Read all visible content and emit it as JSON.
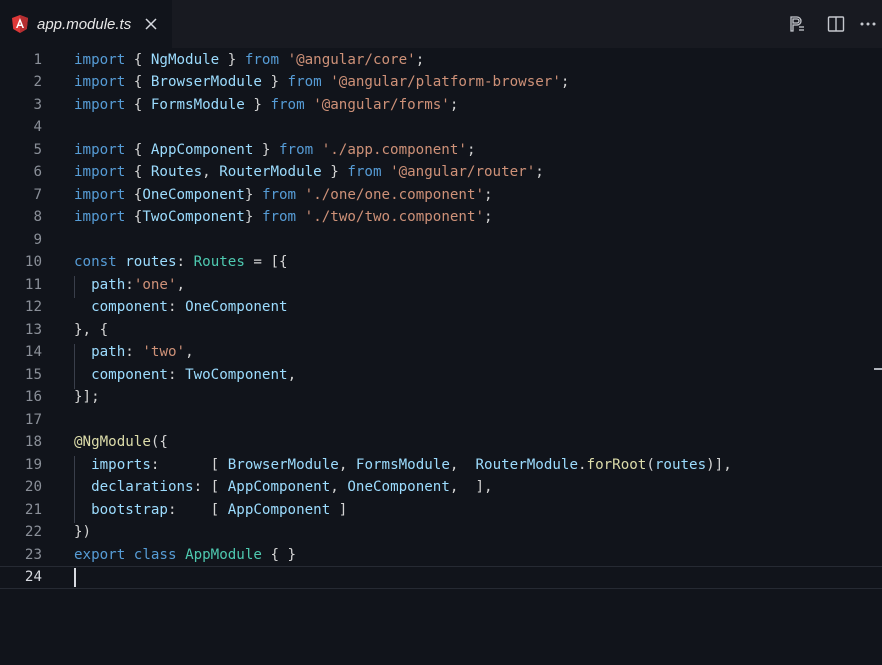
{
  "tab": {
    "title": "app.module.ts",
    "icon": "angular-icon",
    "close_icon": "close-icon"
  },
  "toolbar": {
    "icons": [
      "preview-icon",
      "split-editor-icon",
      "more-actions-icon"
    ]
  },
  "editor": {
    "language": "typescript",
    "current_line": 24,
    "lines": [
      {
        "n": "1",
        "tokens": [
          [
            "kw",
            "import"
          ],
          [
            "punc",
            " { "
          ],
          [
            "id",
            "NgModule"
          ],
          [
            "punc",
            " } "
          ],
          [
            "kw",
            "from"
          ],
          [
            "punc",
            " "
          ],
          [
            "str",
            "'@angular/core'"
          ],
          [
            "punc",
            ";"
          ]
        ]
      },
      {
        "n": "2",
        "tokens": [
          [
            "kw",
            "import"
          ],
          [
            "punc",
            " { "
          ],
          [
            "id",
            "BrowserModule"
          ],
          [
            "punc",
            " } "
          ],
          [
            "kw",
            "from"
          ],
          [
            "punc",
            " "
          ],
          [
            "str",
            "'@angular/platform-browser'"
          ],
          [
            "punc",
            ";"
          ]
        ]
      },
      {
        "n": "3",
        "tokens": [
          [
            "kw",
            "import"
          ],
          [
            "punc",
            " { "
          ],
          [
            "id",
            "FormsModule"
          ],
          [
            "punc",
            " } "
          ],
          [
            "kw",
            "from"
          ],
          [
            "punc",
            " "
          ],
          [
            "str",
            "'@angular/forms'"
          ],
          [
            "punc",
            ";"
          ]
        ]
      },
      {
        "n": "4",
        "tokens": []
      },
      {
        "n": "5",
        "tokens": [
          [
            "kw",
            "import"
          ],
          [
            "punc",
            " { "
          ],
          [
            "id",
            "AppComponent"
          ],
          [
            "punc",
            " } "
          ],
          [
            "kw",
            "from"
          ],
          [
            "punc",
            " "
          ],
          [
            "str",
            "'./app.component'"
          ],
          [
            "punc",
            ";"
          ]
        ]
      },
      {
        "n": "6",
        "tokens": [
          [
            "kw",
            "import"
          ],
          [
            "punc",
            " { "
          ],
          [
            "id",
            "Routes"
          ],
          [
            "punc",
            ", "
          ],
          [
            "id",
            "RouterModule"
          ],
          [
            "punc",
            " } "
          ],
          [
            "kw",
            "from"
          ],
          [
            "punc",
            " "
          ],
          [
            "str",
            "'@angular/router'"
          ],
          [
            "punc",
            ";"
          ]
        ]
      },
      {
        "n": "7",
        "tokens": [
          [
            "kw",
            "import"
          ],
          [
            "punc",
            " {"
          ],
          [
            "id",
            "OneComponent"
          ],
          [
            "punc",
            "} "
          ],
          [
            "kw",
            "from"
          ],
          [
            "punc",
            " "
          ],
          [
            "str",
            "'./one/one.component'"
          ],
          [
            "punc",
            ";"
          ]
        ]
      },
      {
        "n": "8",
        "tokens": [
          [
            "kw",
            "import"
          ],
          [
            "punc",
            " {"
          ],
          [
            "id",
            "TwoComponent"
          ],
          [
            "punc",
            "} "
          ],
          [
            "kw",
            "from"
          ],
          [
            "punc",
            " "
          ],
          [
            "str",
            "'./two/two.component'"
          ],
          [
            "punc",
            ";"
          ]
        ]
      },
      {
        "n": "9",
        "tokens": []
      },
      {
        "n": "10",
        "tokens": [
          [
            "kw",
            "const"
          ],
          [
            "punc",
            " "
          ],
          [
            "id",
            "routes"
          ],
          [
            "punc",
            ": "
          ],
          [
            "type",
            "Routes"
          ],
          [
            "punc",
            " = [{"
          ]
        ]
      },
      {
        "n": "11",
        "tokens": [
          [
            "punc",
            "  "
          ],
          [
            "id",
            "path"
          ],
          [
            "punc",
            ":"
          ],
          [
            "str",
            "'one'"
          ],
          [
            "punc",
            ","
          ]
        ]
      },
      {
        "n": "12",
        "tokens": [
          [
            "punc",
            "  "
          ],
          [
            "id",
            "component"
          ],
          [
            "punc",
            ": "
          ],
          [
            "id",
            "OneComponent"
          ]
        ]
      },
      {
        "n": "13",
        "tokens": [
          [
            "punc",
            "}, {"
          ]
        ]
      },
      {
        "n": "14",
        "tokens": [
          [
            "punc",
            "  "
          ],
          [
            "id",
            "path"
          ],
          [
            "punc",
            ": "
          ],
          [
            "str",
            "'two'"
          ],
          [
            "punc",
            ","
          ]
        ]
      },
      {
        "n": "15",
        "tokens": [
          [
            "punc",
            "  "
          ],
          [
            "id",
            "component"
          ],
          [
            "punc",
            ": "
          ],
          [
            "id",
            "TwoComponent"
          ],
          [
            "punc",
            ","
          ]
        ]
      },
      {
        "n": "16",
        "tokens": [
          [
            "punc",
            "}];"
          ]
        ]
      },
      {
        "n": "17",
        "tokens": []
      },
      {
        "n": "18",
        "tokens": [
          [
            "fn",
            "@NgModule"
          ],
          [
            "punc",
            "({"
          ]
        ]
      },
      {
        "n": "19",
        "tokens": [
          [
            "punc",
            "  "
          ],
          [
            "id",
            "imports"
          ],
          [
            "punc",
            ":      [ "
          ],
          [
            "id",
            "BrowserModule"
          ],
          [
            "punc",
            ", "
          ],
          [
            "id",
            "FormsModule"
          ],
          [
            "punc",
            ",  "
          ],
          [
            "id",
            "RouterModule"
          ],
          [
            "punc",
            "."
          ],
          [
            "fn",
            "forRoot"
          ],
          [
            "punc",
            "("
          ],
          [
            "id",
            "routes"
          ],
          [
            "punc",
            ")],"
          ]
        ]
      },
      {
        "n": "20",
        "tokens": [
          [
            "punc",
            "  "
          ],
          [
            "id",
            "declarations"
          ],
          [
            "punc",
            ": [ "
          ],
          [
            "id",
            "AppComponent"
          ],
          [
            "punc",
            ", "
          ],
          [
            "id",
            "OneComponent"
          ],
          [
            "punc",
            ",  ],"
          ]
        ]
      },
      {
        "n": "21",
        "tokens": [
          [
            "punc",
            "  "
          ],
          [
            "id",
            "bootstrap"
          ],
          [
            "punc",
            ":    [ "
          ],
          [
            "id",
            "AppComponent"
          ],
          [
            "punc",
            " ]"
          ]
        ]
      },
      {
        "n": "22",
        "tokens": [
          [
            "punc",
            "})"
          ]
        ]
      },
      {
        "n": "23",
        "tokens": [
          [
            "kw",
            "export"
          ],
          [
            "punc",
            " "
          ],
          [
            "kw",
            "class"
          ],
          [
            "punc",
            " "
          ],
          [
            "type",
            "AppModule"
          ],
          [
            "punc",
            " { }"
          ]
        ]
      },
      {
        "n": "24",
        "tokens": []
      }
    ]
  }
}
